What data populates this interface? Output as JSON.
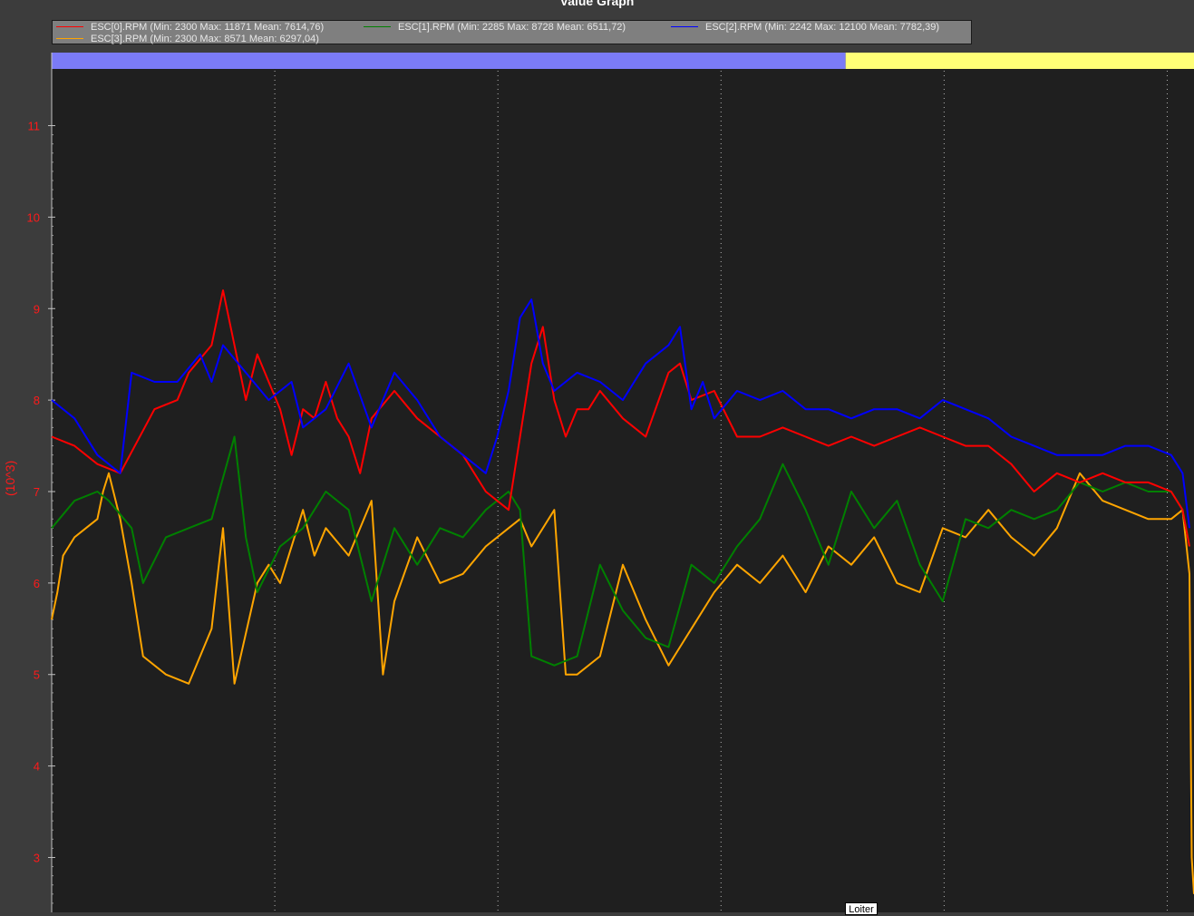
{
  "window": {
    "title": "Value Graph"
  },
  "legend": {
    "items": [
      {
        "label": "ESC[0].RPM  (Min: 2300 Max: 11871 Mean: 7614,76)",
        "color": "#ff0000"
      },
      {
        "label": "ESC[1].RPM  (Min: 2285 Max: 8728 Mean: 6511,72)",
        "color": "#008000"
      },
      {
        "label": "ESC[2].RPM  (Min: 2242 Max: 12100 Mean: 7782,39)",
        "color": "#0000ff"
      },
      {
        "label": "ESC[3].RPM  (Min: 2300 Max: 8571 Mean: 6297,04)",
        "color": "#ffa500"
      }
    ]
  },
  "mode_bar": {
    "segments": [
      {
        "color": "#7b7bf7",
        "start": 0.0,
        "end": 0.695
      },
      {
        "color": "#ffff77",
        "start": 0.695,
        "end": 1.0
      }
    ],
    "visible_label": "Loiter"
  },
  "colors": {
    "background": "#3c3c3c",
    "plot_background": "#1f1f1f",
    "axis_text": "#ff1a1a",
    "grid": "#b4b4b4"
  },
  "chart_data": {
    "type": "line",
    "title": "Value Graph",
    "ylabel": "(10^3)",
    "xlabel": "",
    "ylim": [
      2.4,
      11.6
    ],
    "xlim": [
      0,
      100
    ],
    "yticks": [
      3,
      4,
      5,
      6,
      7,
      8,
      9,
      10,
      11
    ],
    "ytick_labels": [
      "3",
      "4",
      "5",
      "6",
      "7",
      "8",
      "9",
      "10",
      "11"
    ],
    "grid": true,
    "legend_position": "top-left",
    "series": [
      {
        "name": "ESC[0].RPM",
        "color": "#ff0000",
        "x": [
          0,
          2,
          4,
          6,
          9,
          11,
          12,
          14,
          15,
          17,
          18,
          19,
          20,
          21,
          22,
          23,
          24,
          25,
          26,
          27,
          28,
          30,
          32,
          34,
          36,
          38,
          40,
          42,
          43,
          44,
          45,
          46,
          47,
          48,
          50,
          52,
          54,
          55,
          56,
          58,
          60,
          62,
          64,
          66,
          68,
          70,
          72,
          74,
          76,
          78,
          80,
          82,
          84,
          86,
          88,
          90,
          92,
          94,
          96,
          98,
          99,
          99.6
        ],
        "y": [
          7.6,
          7.5,
          7.3,
          7.2,
          7.9,
          8.0,
          8.3,
          8.6,
          9.2,
          8.0,
          8.5,
          8.2,
          7.9,
          7.4,
          7.9,
          7.8,
          8.2,
          7.8,
          7.6,
          7.2,
          7.8,
          8.1,
          7.8,
          7.6,
          7.4,
          7.0,
          6.8,
          8.4,
          8.8,
          8.0,
          7.6,
          7.9,
          7.9,
          8.1,
          7.8,
          7.6,
          8.3,
          8.4,
          8.0,
          8.1,
          7.6,
          7.6,
          7.7,
          7.6,
          7.5,
          7.6,
          7.5,
          7.6,
          7.7,
          7.6,
          7.5,
          7.5,
          7.3,
          7.0,
          7.2,
          7.1,
          7.2,
          7.1,
          7.1,
          7.0,
          6.8,
          6.4
        ]
      },
      {
        "name": "ESC[1].RPM",
        "color": "#008000",
        "x": [
          0,
          2,
          4,
          5,
          7,
          8,
          10,
          12,
          14,
          16,
          17,
          18,
          20,
          22,
          24,
          26,
          28,
          30,
          32,
          34,
          36,
          38,
          40,
          41,
          42,
          44,
          46,
          48,
          50,
          52,
          54,
          56,
          58,
          60,
          62,
          64,
          66,
          68,
          70,
          72,
          74,
          76,
          78,
          80,
          82,
          84,
          86,
          88,
          90,
          92,
          94,
          96,
          98,
          99,
          99.6
        ],
        "y": [
          6.6,
          6.9,
          7.0,
          6.9,
          6.6,
          6.0,
          6.5,
          6.6,
          6.7,
          7.6,
          6.5,
          5.9,
          6.4,
          6.6,
          7.0,
          6.8,
          5.8,
          6.6,
          6.2,
          6.6,
          6.5,
          6.8,
          7.0,
          6.8,
          5.2,
          5.1,
          5.2,
          6.2,
          5.7,
          5.4,
          5.3,
          6.2,
          6.0,
          6.4,
          6.7,
          7.3,
          6.8,
          6.2,
          7.0,
          6.6,
          6.9,
          6.2,
          5.8,
          6.7,
          6.6,
          6.8,
          6.7,
          6.8,
          7.1,
          7.0,
          7.1,
          7.0,
          7.0,
          6.8,
          6.4
        ]
      },
      {
        "name": "ESC[2].RPM",
        "color": "#0000ff",
        "x": [
          0,
          2,
          4,
          6,
          7,
          9,
          11,
          13,
          14,
          15,
          17,
          19,
          21,
          22,
          24,
          26,
          28,
          30,
          32,
          34,
          36,
          38,
          39,
          40,
          41,
          42,
          43,
          44,
          46,
          48,
          50,
          52,
          54,
          55,
          56,
          57,
          58,
          60,
          62,
          64,
          66,
          68,
          70,
          72,
          74,
          76,
          78,
          80,
          82,
          84,
          86,
          88,
          90,
          92,
          94,
          96,
          98,
          99,
          99.6
        ],
        "y": [
          8.0,
          7.8,
          7.4,
          7.2,
          8.3,
          8.2,
          8.2,
          8.5,
          8.2,
          8.6,
          8.3,
          8.0,
          8.2,
          7.7,
          7.9,
          8.4,
          7.7,
          8.3,
          8.0,
          7.6,
          7.4,
          7.2,
          7.6,
          8.1,
          8.9,
          9.1,
          8.4,
          8.1,
          8.3,
          8.2,
          8.0,
          8.4,
          8.6,
          8.8,
          7.9,
          8.2,
          7.8,
          8.1,
          8.0,
          8.1,
          7.9,
          7.9,
          7.8,
          7.9,
          7.9,
          7.8,
          8.0,
          7.9,
          7.8,
          7.6,
          7.5,
          7.4,
          7.4,
          7.4,
          7.5,
          7.5,
          7.4,
          7.2,
          6.6
        ]
      },
      {
        "name": "ESC[3].RPM",
        "color": "#ffa500",
        "x": [
          0,
          0.5,
          1,
          2,
          3,
          4,
          4.5,
          5,
          6,
          7,
          8,
          10,
          12,
          14,
          15,
          16,
          18,
          19,
          20,
          22,
          23,
          24,
          26,
          28,
          29,
          30,
          32,
          34,
          36,
          38,
          40,
          41,
          42,
          44,
          45,
          46,
          48,
          50,
          52,
          54,
          55,
          56,
          58,
          60,
          62,
          64,
          66,
          68,
          70,
          72,
          74,
          76,
          78,
          80,
          82,
          84,
          86,
          88,
          90,
          92,
          94,
          96,
          98,
          99,
          99.6,
          99.8,
          100
        ],
        "y": [
          5.6,
          5.9,
          6.3,
          6.5,
          6.6,
          6.7,
          7.0,
          7.2,
          6.7,
          6.0,
          5.2,
          5.0,
          4.9,
          5.5,
          6.6,
          4.9,
          6.0,
          6.2,
          6.0,
          6.8,
          6.3,
          6.6,
          6.3,
          6.9,
          5.0,
          5.8,
          6.5,
          6.0,
          6.1,
          6.4,
          6.6,
          6.7,
          6.4,
          6.8,
          5.0,
          5.0,
          5.2,
          6.2,
          5.6,
          5.1,
          5.3,
          5.5,
          5.9,
          6.2,
          6.0,
          6.3,
          5.9,
          6.4,
          6.2,
          6.5,
          6.0,
          5.9,
          6.6,
          6.5,
          6.8,
          6.5,
          6.3,
          6.6,
          7.2,
          6.9,
          6.8,
          6.7,
          6.7,
          6.8,
          6.1,
          3.0,
          2.6
        ]
      }
    ]
  }
}
